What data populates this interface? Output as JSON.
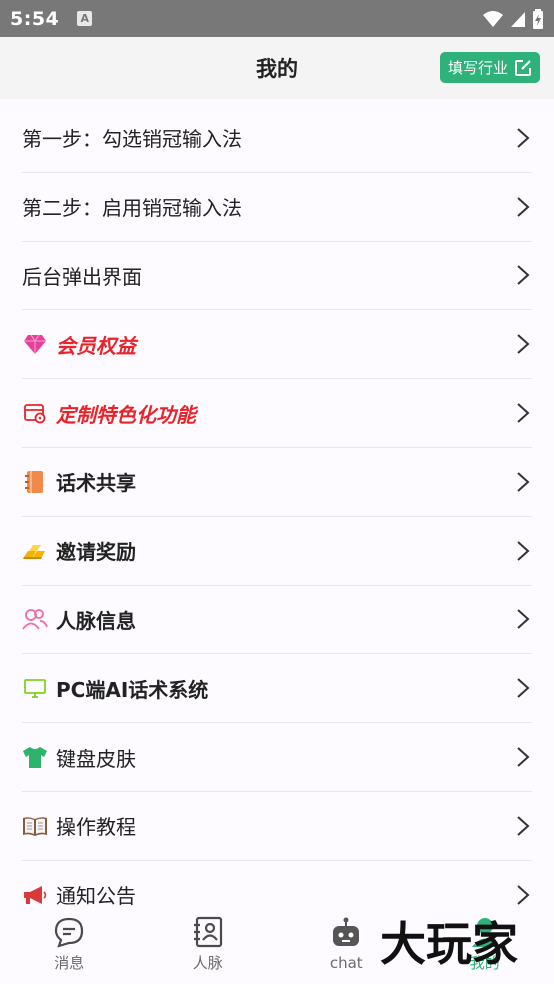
{
  "status_bar": {
    "time": "5:54",
    "a_badge": "A"
  },
  "header": {
    "title": "我的",
    "fill_button": "填写行业"
  },
  "menu": [
    {
      "label": "第一步：勾选销冠输入法",
      "style": "plain",
      "icon": "none"
    },
    {
      "label": "第二步：启用销冠输入法",
      "style": "plain",
      "icon": "none"
    },
    {
      "label": "后台弹出界面",
      "style": "plain",
      "icon": "none"
    },
    {
      "label": "会员权益",
      "style": "red",
      "icon": "diamond-icon"
    },
    {
      "label": "定制特色化功能",
      "style": "red",
      "icon": "custom-feature-icon"
    },
    {
      "label": "话术共享",
      "style": "bold",
      "icon": "notebook-icon"
    },
    {
      "label": "邀请奖励",
      "style": "bold",
      "icon": "gold-bars-icon"
    },
    {
      "label": "人脉信息",
      "style": "bold",
      "icon": "contacts-icon"
    },
    {
      "label": "PC端AI话术系统",
      "style": "bold",
      "icon": "monitor-icon"
    },
    {
      "label": "键盘皮肤",
      "style": "plain",
      "icon": "tshirt-icon"
    },
    {
      "label": "操作教程",
      "style": "plain",
      "icon": "book-icon"
    },
    {
      "label": "通知公告",
      "style": "plain",
      "icon": "megaphone-icon"
    }
  ],
  "tabs": [
    {
      "label": "消息",
      "icon": "message-icon"
    },
    {
      "label": "人脉",
      "icon": "contact-card-icon"
    },
    {
      "label": "chat",
      "icon": "robot-icon"
    },
    {
      "label": "我的",
      "icon": "profile-icon"
    }
  ],
  "watermark": {
    "text": "大玩家"
  },
  "colors": {
    "accent": "#2fb17a",
    "highlight_red": "#e8242a",
    "status_bar": "#787878"
  }
}
